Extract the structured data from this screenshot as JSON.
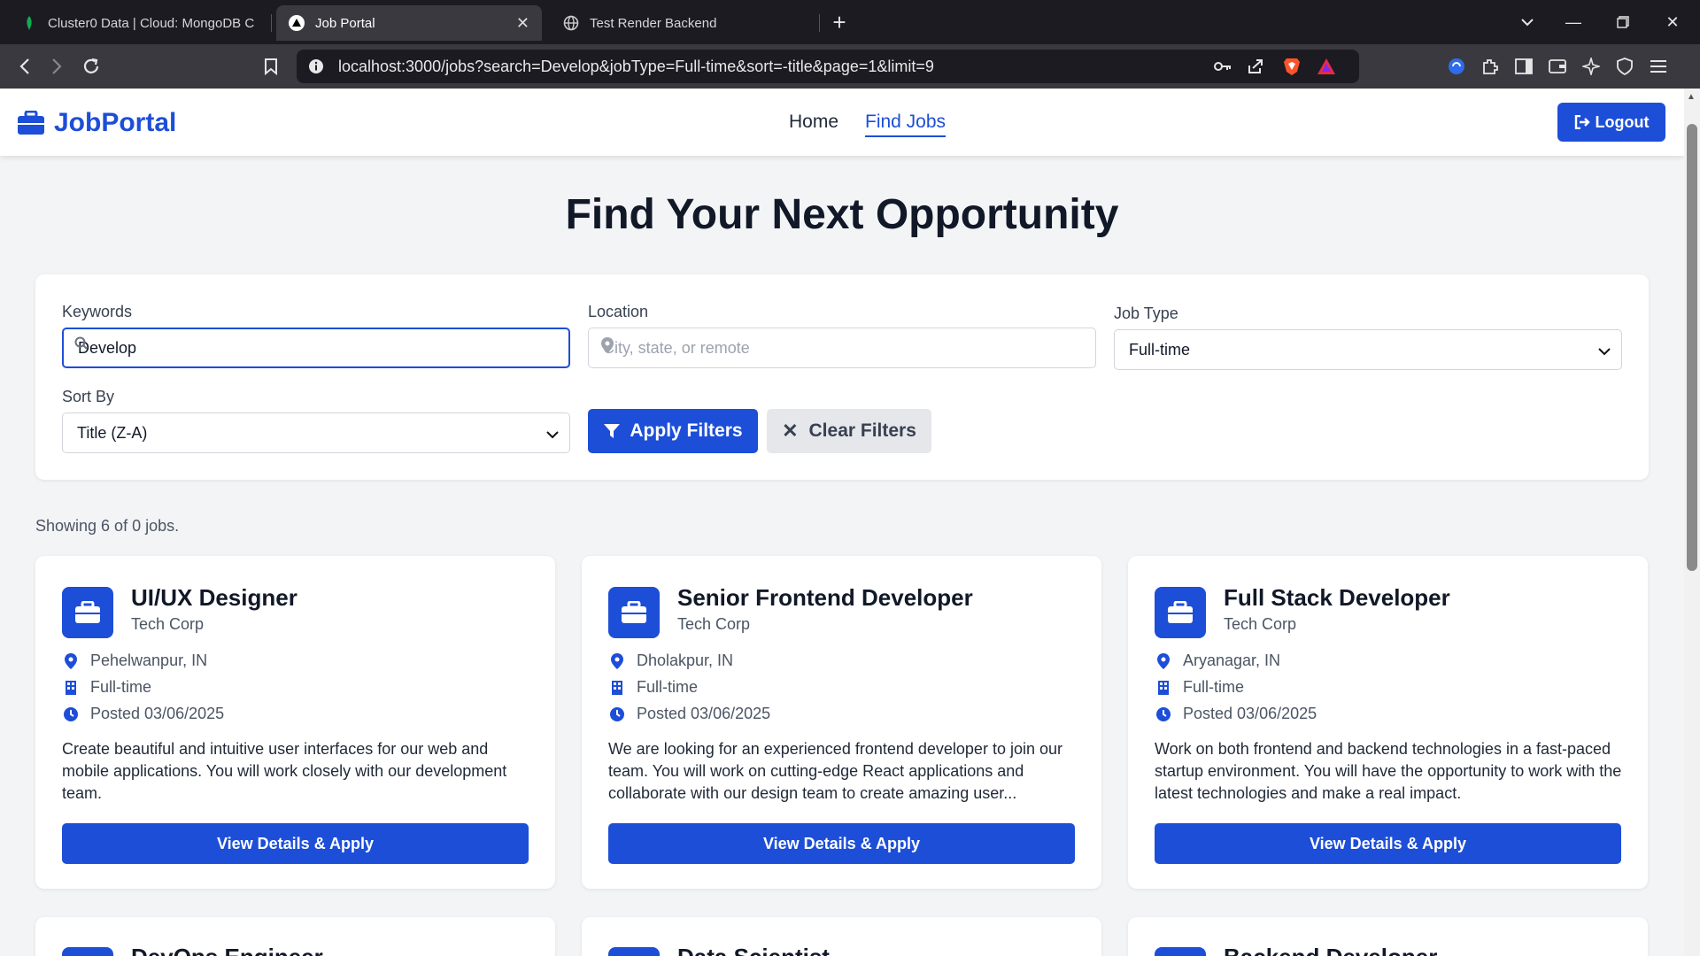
{
  "browser": {
    "tabs": [
      {
        "title": "Cluster0 Data | Cloud: MongoDB Cloud",
        "icon": "mongodb-leaf-icon"
      },
      {
        "title": "Job Portal",
        "icon": "app-triangle-icon"
      },
      {
        "title": "Test Render Backend",
        "icon": "globe-icon"
      }
    ],
    "url": "localhost:3000/jobs?search=Develop&jobType=Full-time&sort=-title&page=1&limit=9"
  },
  "nav": {
    "brand": "JobPortal",
    "links": [
      "Home",
      "Find Jobs"
    ],
    "active_link": "Find Jobs",
    "logout_label": "Logout"
  },
  "page": {
    "heading": "Find Your Next Opportunity"
  },
  "filters": {
    "keywords_label": "Keywords",
    "keywords_value": "Develop",
    "location_label": "Location",
    "location_placeholder": "City, state, or remote",
    "job_type_label": "Job Type",
    "job_type_value": "Full-time",
    "sort_label": "Sort By",
    "sort_value": "Title (Z-A)",
    "apply_label": "Apply Filters",
    "clear_label": "Clear Filters"
  },
  "results": {
    "summary": "Showing 6 of 0 jobs.",
    "button_label": "View Details & Apply",
    "jobs": [
      {
        "title": "UI/UX Designer",
        "company": "Tech Corp",
        "location": "Pehelwanpur, IN",
        "type": "Full-time",
        "posted": "Posted 03/06/2025",
        "description": "Create beautiful and intuitive user interfaces for our web and mobile applications. You will work closely with our development team."
      },
      {
        "title": "Senior Frontend Developer",
        "company": "Tech Corp",
        "location": "Dholakpur, IN",
        "type": "Full-time",
        "posted": "Posted 03/06/2025",
        "description": "We are looking for an experienced frontend developer to join our team. You will work on cutting-edge React applications and collaborate with our design team to create amazing user..."
      },
      {
        "title": "Full Stack Developer",
        "company": "Tech Corp",
        "location": "Aryanagar, IN",
        "type": "Full-time",
        "posted": "Posted 03/06/2025",
        "description": "Work on both frontend and backend technologies in a fast-paced startup environment. You will have the opportunity to work with the latest technologies and make a real impact."
      }
    ],
    "next_row_titles": [
      "DevOps Engineer",
      "Data Scientist",
      "Backend Developer"
    ]
  }
}
